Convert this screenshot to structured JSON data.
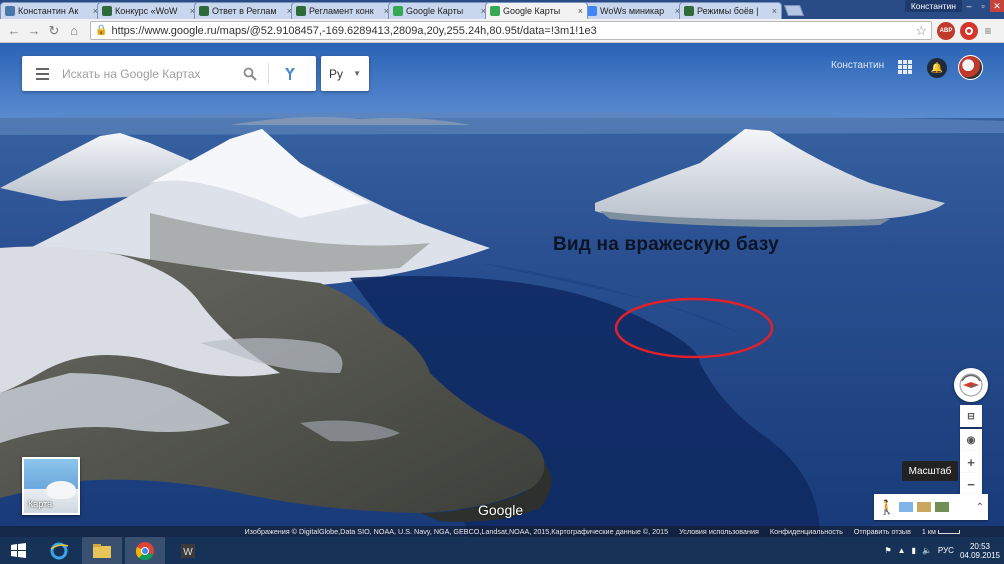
{
  "browser": {
    "tabs": [
      {
        "label": "Константин Ак",
        "icon": "vk-icon",
        "color": "#4a76a8",
        "active": false
      },
      {
        "label": "Конкурс «WoW",
        "icon": "wows-icon",
        "color": "#2f6b3a",
        "active": false
      },
      {
        "label": "Ответ в Реглам",
        "icon": "wows-icon",
        "color": "#2f6b3a",
        "active": false
      },
      {
        "label": "Регламент конк",
        "icon": "wows-icon",
        "color": "#2f6b3a",
        "active": false
      },
      {
        "label": "Google Карты",
        "icon": "maps-icon",
        "color": "#34a853",
        "active": false
      },
      {
        "label": "Google Карты",
        "icon": "maps-icon",
        "color": "#34a853",
        "active": true
      },
      {
        "label": "WoWs миникар",
        "icon": "google-icon",
        "color": "#4285f4",
        "active": false
      },
      {
        "label": "Режимы боёв |",
        "icon": "wows-icon",
        "color": "#2f6b3a",
        "active": false
      }
    ],
    "user_chip": "Константин",
    "url": "https://www.google.ru/maps/@52.9108457,-169.6289413,2809a,20y,255.24h,80.95t/data=!3m1!1e3",
    "extensions": [
      {
        "label": "ABP",
        "color": "#c0392b"
      },
      {
        "label": "",
        "color": "#d4362b"
      }
    ]
  },
  "map": {
    "search_placeholder": "Искать на Google Картах",
    "language": "Ру",
    "username": "Константин",
    "annotation": "Вид на вражескую базу",
    "annotation_ellipse_color": "#e0202a",
    "thumbnail_label": "Карта",
    "logo": "Google",
    "scale_tooltip": "Масштаб",
    "attribution": {
      "imagery": "Изображения © DigitalGlobe,Data SIO, NOAA, U.S. Navy, NGA, GEBCO,Landsat,NOAA, 2015,Картографические данные ©, 2015",
      "terms": "Условия использования",
      "privacy": "Конфиденциальность",
      "feedback": "Отправить отзыв",
      "scale": "1 км"
    }
  },
  "taskbar": {
    "language": "РУС",
    "time": "20:53",
    "date": "04.09.2015"
  }
}
